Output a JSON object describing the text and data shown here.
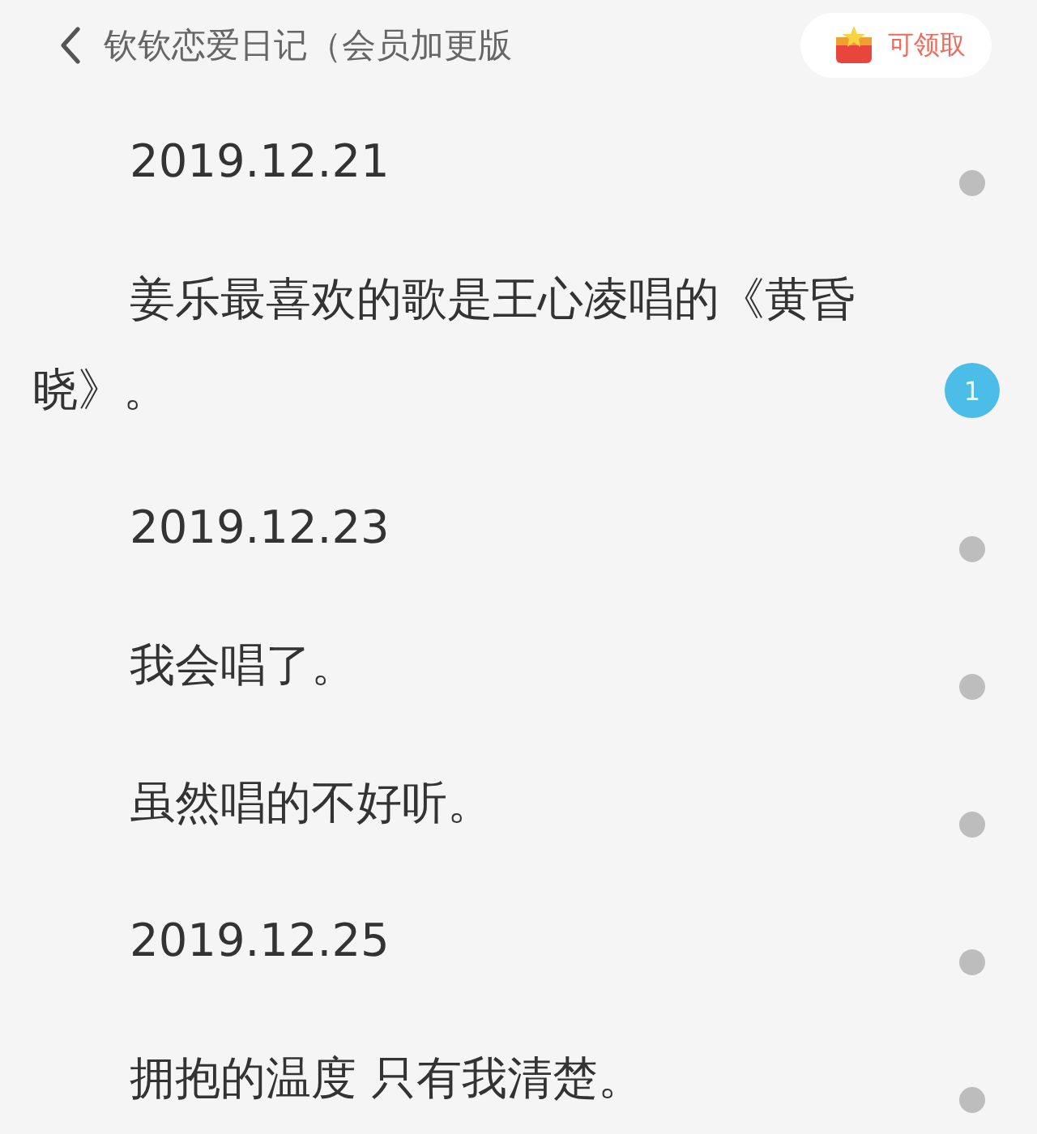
{
  "header": {
    "title": "钦钦恋爱日记（会员加更版",
    "reward_button": "可领取"
  },
  "paragraphs": [
    {
      "text": "2019.12.21",
      "marker": {
        "kind": "dot"
      }
    },
    {
      "text": "姜乐最喜欢的歌是王心凌唱的《黄昏晓》。",
      "marker": {
        "kind": "count",
        "count": "1"
      }
    },
    {
      "text": "2019.12.23",
      "marker": {
        "kind": "dot"
      }
    },
    {
      "text": "我会唱了。",
      "marker": {
        "kind": "dot"
      }
    },
    {
      "text": "虽然唱的不好听。",
      "marker": {
        "kind": "dot"
      }
    },
    {
      "text": "2019.12.25",
      "marker": {
        "kind": "dot"
      }
    },
    {
      "text": "拥抱的温度 只有我清楚。",
      "marker": {
        "kind": "dot"
      }
    }
  ]
}
